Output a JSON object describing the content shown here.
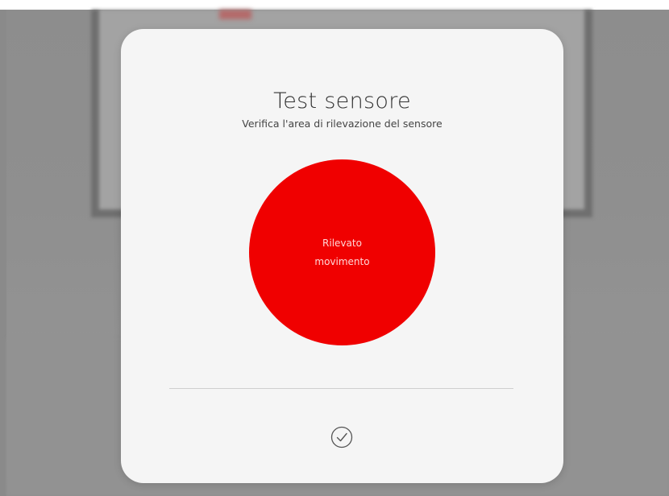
{
  "dialog": {
    "title": "Test sensore",
    "subtitle": "Verifica l'area di rilevazione del sensore",
    "status": {
      "line1": "Rilevato",
      "line2": "movimento",
      "color": "#f00000"
    },
    "confirm_icon": "checkmark-circle-icon"
  }
}
